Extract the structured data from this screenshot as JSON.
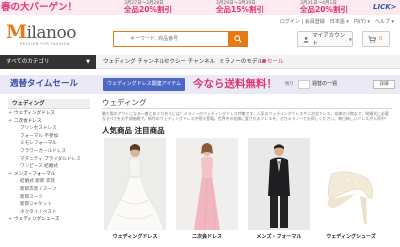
{
  "promo": {
    "title": "春の大バーゲン！",
    "segments": [
      {
        "date": "3月27日～3月28日",
        "off": "全品20%割引"
      },
      {
        "date": "3月29日～3月30日",
        "off": "全品15%割引"
      },
      {
        "date": "3月31日～4月1日",
        "off": "全品20%割引"
      }
    ],
    "cta": "LICK>"
  },
  "header": {
    "logo_text": "ilanoo",
    "logo_initial": "M",
    "tagline": "PASSION FOR FASHION",
    "links": [
      "ログイン | 会員登録",
      "日本語 ▾",
      "円(Y) ▾",
      "ヘルプ ▾"
    ],
    "search_placeholder": "キーワード, 商品番号",
    "account_label": "マイアカウント",
    "cart_count": "0"
  },
  "nav": {
    "all_categories": "すべてのカテゴリ",
    "items": [
      "ウェディング チャンネル",
      "セクシー チャンネル",
      "ミラノーのモデル",
      "セール"
    ]
  },
  "salebar": {
    "title": "週替タイムセール",
    "tag": "ウェディングドレス関連アイテム",
    "big": "今なら送料無料！",
    "remain": "残り",
    "link": "週替の一週",
    "button": "詳細"
  },
  "sidebar": {
    "header": "ウェディング",
    "items": [
      {
        "label": "ウェディングドレス",
        "type": "cat"
      },
      {
        "label": "二次会ドレス",
        "type": "cat"
      },
      {
        "label": "プリンセスドレス",
        "type": "sub"
      },
      {
        "label": "フォーマル 不参加",
        "type": "sub"
      },
      {
        "label": "ミモレフォーマル",
        "type": "sub"
      },
      {
        "label": "フラワーガールドレス",
        "type": "sub"
      },
      {
        "label": "マタニティ プライダルドレス",
        "type": "sub"
      },
      {
        "label": "ワンピース 結婚式",
        "type": "sub"
      },
      {
        "label": "メンズ・フォーマル",
        "type": "cat"
      },
      {
        "label": "結婚式 新郎 衣装",
        "type": "sub"
      },
      {
        "label": "新郎衣装 / スーツ",
        "type": "sub"
      },
      {
        "label": "新郎スーツ",
        "type": "sub"
      },
      {
        "label": "新郎ジャケット",
        "type": "sub"
      },
      {
        "label": "ネクタイ / ベスト",
        "type": "sub"
      },
      {
        "label": "ウェディングシューズ",
        "type": "cat"
      }
    ]
  },
  "main": {
    "title": "ウェディング",
    "description": "最大限のアウトになる一着とめぐり合うには？ミラノーのウェディングドレス特集です。人気のウェディングドレスや二次会ドレス、花嫁の小物まで、結婚式に必要なすべてをお手頃価格で。新作のウェディングドレスが続々登場。世界中の花嫁に愛されるドレスを、ぜひミラノーでお探しください。毎日新しいドレスが入荷中！",
    "popular_title": "人気商品  注目商品",
    "products": [
      {
        "name": "ウェディングドレス"
      },
      {
        "name": "二次会ドレス"
      },
      {
        "name": "メンズ・フォーマル"
      },
      {
        "name": "ウェディングシューズ"
      }
    ]
  },
  "colors": {
    "accent_orange": "#e87a16",
    "sale_pink": "#e3367a",
    "sale_blue": "#3a4aa8",
    "nav_dark": "#333333"
  },
  "icons": [
    "search-icon",
    "user-icon",
    "cart-icon",
    "chevron-down-icon",
    "plus-icon"
  ]
}
